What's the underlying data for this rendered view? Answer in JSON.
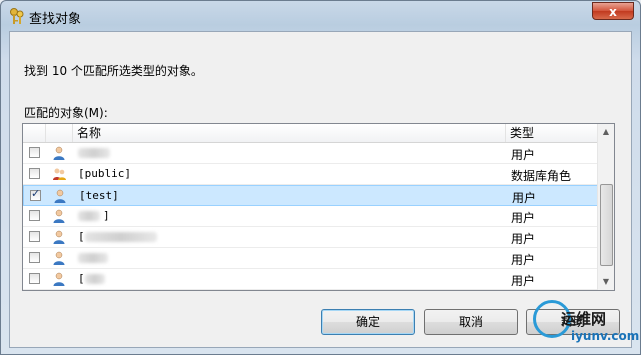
{
  "window": {
    "title": "查找对象",
    "close_label": "x"
  },
  "found_text": "找到 10 个匹配所选类型的对象。",
  "matches_label": "匹配的对象(M):",
  "columns": {
    "name": "名称",
    "type": "类型"
  },
  "rows": [
    {
      "checked": false,
      "icon": "user-icon",
      "name": "",
      "type": "用户",
      "selected": false
    },
    {
      "checked": false,
      "icon": "role-icon",
      "name": "[public]",
      "type": "数据库角色",
      "selected": false
    },
    {
      "checked": true,
      "icon": "user-icon",
      "name": "[test]",
      "type": "用户",
      "selected": true
    },
    {
      "checked": false,
      "icon": "user-icon",
      "name": "]",
      "type": "用户",
      "selected": false
    },
    {
      "checked": false,
      "icon": "user-icon",
      "name": "[",
      "type": "用户",
      "selected": false
    },
    {
      "checked": false,
      "icon": "user-icon",
      "name": "",
      "type": "用户",
      "selected": false
    },
    {
      "checked": false,
      "icon": "user-icon",
      "name": "[",
      "type": "用户",
      "selected": false
    }
  ],
  "buttons": {
    "ok": "确定",
    "cancel": "取消",
    "help": "帮助"
  },
  "watermark": {
    "line1": "运维网",
    "line2": "iyunv.com"
  }
}
